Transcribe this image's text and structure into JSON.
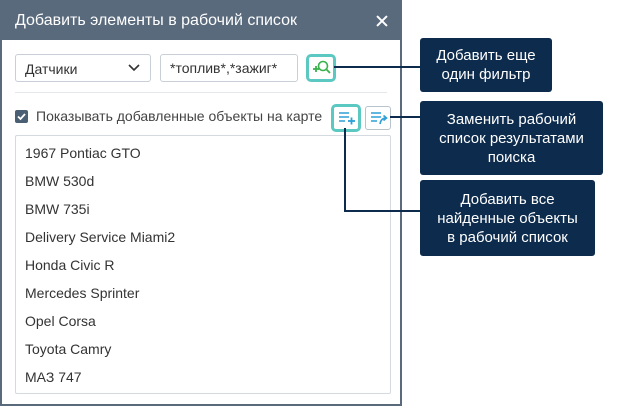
{
  "dialog": {
    "title": "Добавить элементы в рабочий список",
    "close_icon": "close-icon"
  },
  "filter": {
    "type_value": "Датчики",
    "mask_value": "*топлив*,*зажиг*",
    "add_filter_icon": "add-filter-icon"
  },
  "show_on_map": {
    "checked": true,
    "label": "Показывать добавленные объекты на карте"
  },
  "actions": {
    "add_all_icon": "list-add-icon",
    "replace_icon": "list-replace-icon"
  },
  "results": [
    "1967 Pontiac GTO",
    "BMW 530d",
    "BMW 735i",
    "Delivery Service Miami2",
    "Honda Civic R",
    "Mercedes Sprinter",
    "Opel Corsa",
    "Toyota Camry",
    "МАЗ 747"
  ],
  "callouts": {
    "add_filter": [
      "Добавить еще",
      "один фильтр"
    ],
    "replace": [
      "Заменить рабочий",
      "список результатами",
      "поиска"
    ],
    "add_all": [
      "Добавить все",
      "найденные объекты",
      "в рабочий список"
    ]
  },
  "colors": {
    "header": "#596a7d",
    "callout": "#0d2b4c",
    "accent": "#2b9fd6",
    "add_green": "#38b24a"
  }
}
